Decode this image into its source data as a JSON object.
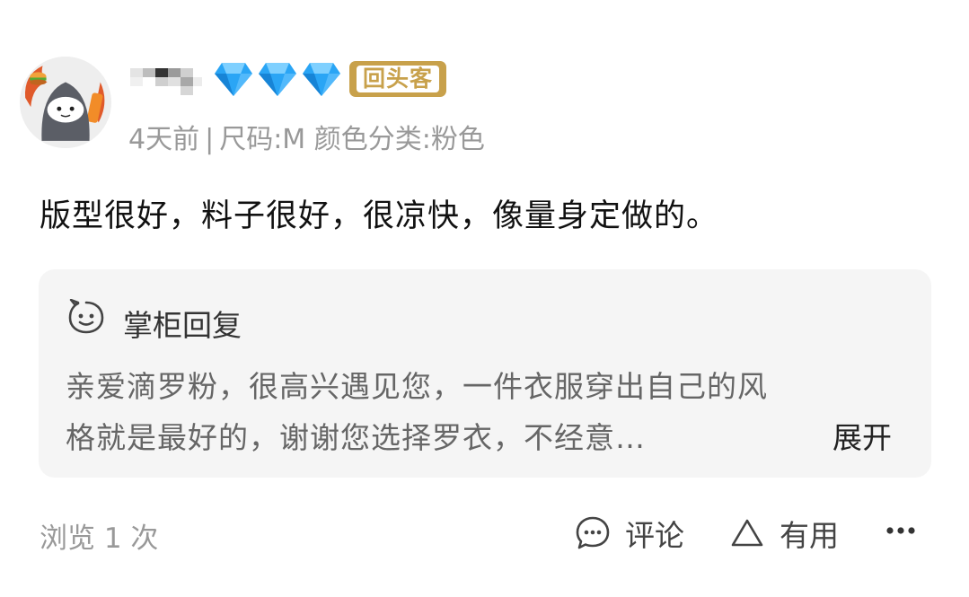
{
  "review": {
    "meta": {
      "time": "4天前",
      "separator": "|",
      "size": "尺码:M",
      "color_category": "颜色分类:粉色"
    },
    "badge_label": "回头客",
    "diamond_level": 3,
    "text": "版型很好，料子很好，很凉快，像量身定做的。"
  },
  "reply": {
    "title": "掌柜回复",
    "line1": "亲爱滴罗粉，很高兴遇见您，一件衣服穿出自己的风",
    "line2": "格就是最好的，谢谢您选择罗衣，不经意…",
    "expand_label": "展开"
  },
  "footer": {
    "views": "浏览 1 次",
    "comment_label": "评论",
    "helpful_label": "有用"
  },
  "icons": {
    "avatar": "avatar-ninja-icon",
    "diamond": "diamond-icon",
    "reply": "smiley-icon",
    "comment": "comment-bubble-icon",
    "helpful": "triangle-icon",
    "more": "more-icon"
  },
  "colors": {
    "badge": "#c8a14b",
    "diamond": "#2aa5f5",
    "meta_text": "#999999",
    "reply_bg": "#f5f5f5"
  }
}
